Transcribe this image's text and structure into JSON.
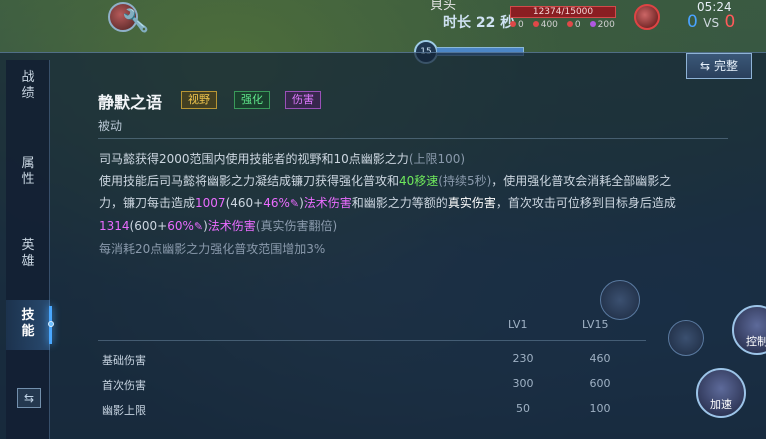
{
  "hud": {
    "title": "貝头",
    "duration": "时长 22 秒",
    "hp": "12374/15000",
    "stats": [
      "0",
      "400",
      "0",
      "200"
    ],
    "clock": "05:24",
    "score_blue": "0",
    "score_vs": "VS",
    "score_red": "0",
    "level": "15",
    "level_progress": 1.0
  },
  "sidebar": {
    "items": [
      {
        "label": "战\n绩"
      },
      {
        "label": "属\n性"
      },
      {
        "label": "英\n雄"
      },
      {
        "label": "技\n能"
      }
    ],
    "swap_icon": "⇆"
  },
  "complete_button": {
    "icon": "⇆",
    "label": "完整"
  },
  "skill": {
    "name": "静默之语",
    "tags": [
      "视野",
      "强化",
      "伤害"
    ],
    "type": "被动",
    "line1_a": "司马懿获得2000范围内使用技能者的视野和10点幽影之力",
    "line1_b": "(上限100)",
    "line2_a": "使用技能后司马懿将幽影之力凝结成镰刀获得强化普攻和",
    "line2_b": "40移速",
    "line2_c": "(持续5秒)",
    "line2_d": "，使用强化普攻会消耗全部幽影之",
    "line3_a": "力，镰刀每击造成",
    "line3_b": "1007",
    "line3_c": "(460+",
    "line3_d": "46%",
    "line3_e": ")",
    "line3_f": "法术伤害",
    "line3_g": "和幽影之力等额的",
    "line3_h": "真实伤害",
    "line3_i": "，首次攻击可位移到目标身后造成",
    "line4_a": "1314",
    "line4_b": "(600+",
    "line4_c": "60%",
    "line4_d": ")",
    "line4_e": "法术伤害",
    "line4_f": "(真实伤害翻倍)",
    "line5": "每消耗20点幽影之力强化普攻范围增加3%"
  },
  "table": {
    "headers": [
      "LV1",
      "LV15"
    ],
    "rows": [
      {
        "name": "基础伤害",
        "lv1": "230",
        "lv15": "460"
      },
      {
        "name": "首次伤害",
        "lv1": "300",
        "lv15": "600"
      },
      {
        "name": "幽影上限",
        "lv1": "50",
        "lv15": "100"
      }
    ]
  },
  "controls": {
    "control_label": "控制",
    "speed_label": "加速"
  },
  "colors": {
    "accent": "#4aa8ff",
    "tag_vision": "#f1c64e",
    "tag_buff": "#5fe68a",
    "tag_damage": "#e07aff"
  }
}
